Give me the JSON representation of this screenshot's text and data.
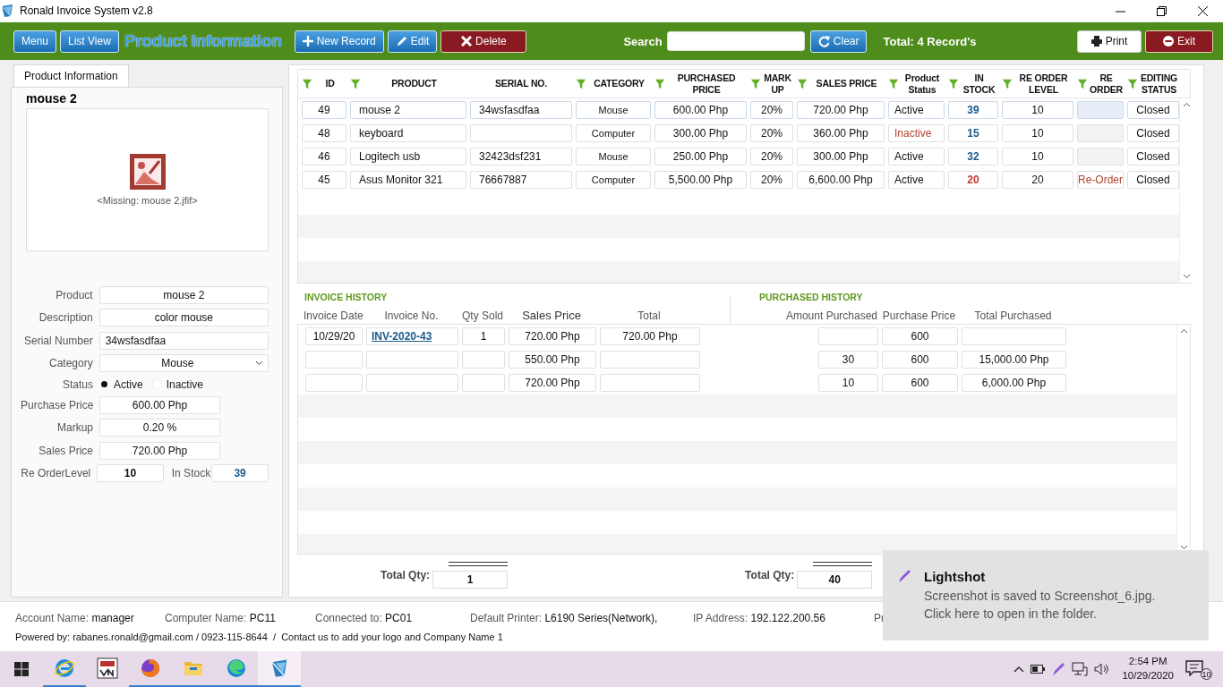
{
  "window": {
    "title": "Ronald Invoice System v2.8"
  },
  "toolbar": {
    "nav_buttons": [
      "Menu",
      "List View"
    ],
    "heading": "Product Information",
    "actions": [
      {
        "label": "New Record",
        "kind": "add"
      },
      {
        "label": "Edit",
        "kind": "edit"
      },
      {
        "label": "Delete",
        "kind": "delete"
      }
    ],
    "search": {
      "label": "Search"
    },
    "clear_button": "Clear",
    "total": "Total: 4 Record's",
    "print_button": "Print",
    "exit_button": "Exit"
  },
  "form": {
    "tabs": [
      {
        "label": "Product Information",
        "selected": true
      }
    ],
    "name": "mouse 2",
    "image_caption": "<Missing: mouse 2.jfif>",
    "fields": [
      {
        "kind": "center",
        "label": "Product",
        "value": "mouse 2"
      },
      {
        "kind": "center",
        "label": "Description",
        "value": "color mouse"
      },
      {
        "kind": "left",
        "label": "Serial Number",
        "value": "34wsfasdfaa"
      },
      {
        "kind": "select",
        "label": "Category",
        "value": "Mouse"
      },
      {
        "kind": "radio",
        "label": "Status",
        "options": [
          {
            "label": "Active",
            "selected": true
          },
          {
            "label": "Inactive",
            "selected": false
          }
        ]
      },
      {
        "kind": "short",
        "label": "Purchase Price",
        "value": "600.00 Php"
      },
      {
        "kind": "short",
        "label": "Markup",
        "value": "0.20 %"
      },
      {
        "kind": "short",
        "label": "Sales Price",
        "value": "720.00 Php"
      },
      {
        "kind": "pair",
        "label": "Re OrderLevel",
        "value": "10",
        "label_2": "In Stock",
        "value_2": "39"
      }
    ]
  },
  "products": {
    "columns": [
      {
        "label": "ID",
        "filter": true
      },
      {
        "label": "PRODUCT",
        "filter": true
      },
      {
        "label": "SERIAL NO.",
        "filter": false
      },
      {
        "label": "CATEGORY",
        "filter": true
      },
      {
        "label": "PURCHASED PRICE",
        "filter": true
      },
      {
        "label": "MARK UP",
        "filter": true
      },
      {
        "label": "SALES PRICE",
        "filter": true
      },
      {
        "label": "Product Status",
        "filter": true
      },
      {
        "label": "IN STOCK",
        "filter": true
      },
      {
        "label": "RE ORDER LEVEL",
        "filter": true
      },
      {
        "label": "RE ORDER",
        "filter": true
      },
      {
        "label": "EDITING STATUS",
        "filter": true
      }
    ],
    "rows": [
      {
        "selected": true,
        "id": "49",
        "product": "mouse 2",
        "serial": "34wsfasdfaa",
        "category": "Mouse",
        "purchased_price": "600.00 Php",
        "markup": "20%",
        "sales_price": "720.00 Php",
        "status": "Active",
        "inactive": false,
        "in_stock": "39",
        "low_stock": false,
        "reorder_level": "10",
        "editing": "Closed"
      },
      {
        "selected": false,
        "id": "48",
        "product": "keyboard",
        "category": "Computer",
        "purchased_price": "300.00 Php",
        "markup": "20%",
        "sales_price": "360.00 Php",
        "status": "Inactive",
        "inactive": true,
        "in_stock": "15",
        "low_stock": false,
        "reorder_level": "10",
        "editing": "Closed"
      },
      {
        "selected": false,
        "id": "46",
        "product": "Logitech usb",
        "serial": "32423dsf231",
        "category": "Mouse",
        "purchased_price": "250.00 Php",
        "markup": "20%",
        "sales_price": "300.00 Php",
        "status": "Active",
        "inactive": false,
        "in_stock": "32",
        "low_stock": false,
        "reorder_level": "10",
        "editing": "Closed"
      },
      {
        "selected": false,
        "id": "45",
        "product": "Asus Monitor 321",
        "serial": "76667887",
        "category": "Computer",
        "purchased_price": "5,500.00 Php",
        "markup": "20%",
        "sales_price": "6,600.00 Php",
        "status": "Active",
        "inactive": false,
        "in_stock": "20",
        "low_stock": true,
        "reorder_level": "20",
        "reorder": "Re-Order",
        "editing": "Closed"
      }
    ]
  },
  "invoice_history": {
    "title": "INVOICE HISTORY",
    "columns": [
      "Invoice Date",
      "Invoice No.",
      "Qty Sold",
      "Sales Price",
      "Total"
    ],
    "rows": [
      {
        "date": "10/29/20",
        "number": "INV-2020-43",
        "qty": "1",
        "price": "720.00 Php",
        "total": "720.00 Php"
      },
      {
        "price": "550.00 Php"
      },
      {
        "price": "720.00 Php"
      }
    ],
    "total": {
      "label": "Total Qty:",
      "value": "1"
    }
  },
  "purchased_history": {
    "title": "PURCHASED HISTORY",
    "columns": [
      "Amount Purchased",
      "Purchase Price",
      "Total Purchased"
    ],
    "rows": [
      {
        "price": "600"
      },
      {
        "amount": "30",
        "price": "600",
        "total": "15,000.00 Php"
      },
      {
        "amount": "10",
        "price": "600",
        "total": "6,000.00 Php"
      }
    ],
    "total": {
      "label": "Total Qty:",
      "value": "40"
    }
  },
  "status_bar": {
    "items": [
      {
        "label": "Account Name:",
        "value": "manager"
      },
      {
        "label": "Computer Name:",
        "value": "PC11"
      },
      {
        "label": "Connected to:",
        "value": "PC01"
      },
      {
        "label": "Default Printer:",
        "value": "L6190 Series(Network),"
      },
      {
        "label": "IP Address:",
        "value": "192.122.200.56"
      },
      {
        "label": "Pr"
      }
    ],
    "footer": "Powered by: rabanes.ronald@gmail.com / 0923-115-8644  /  Contact us to add your logo and Company Name 1"
  },
  "notification": {
    "title": "Lightshot",
    "message": [
      "Screenshot is saved to Screenshot_6.jpg.",
      "Click here to open in the folder."
    ]
  },
  "taskbar": {
    "apps": [
      {
        "kind": "browser-e",
        "running": true,
        "selected": false
      },
      {
        "kind": "remote",
        "running": false,
        "selected": false
      },
      {
        "kind": "fox",
        "running": true,
        "selected": false
      },
      {
        "kind": "folder",
        "running": true,
        "selected": false
      },
      {
        "kind": "browser-wave",
        "running": true,
        "selected": false
      },
      {
        "kind": "app",
        "running": true,
        "selected": true
      }
    ],
    "time": "2:54 PM",
    "date": "10/29/2020",
    "notifications": "10"
  }
}
